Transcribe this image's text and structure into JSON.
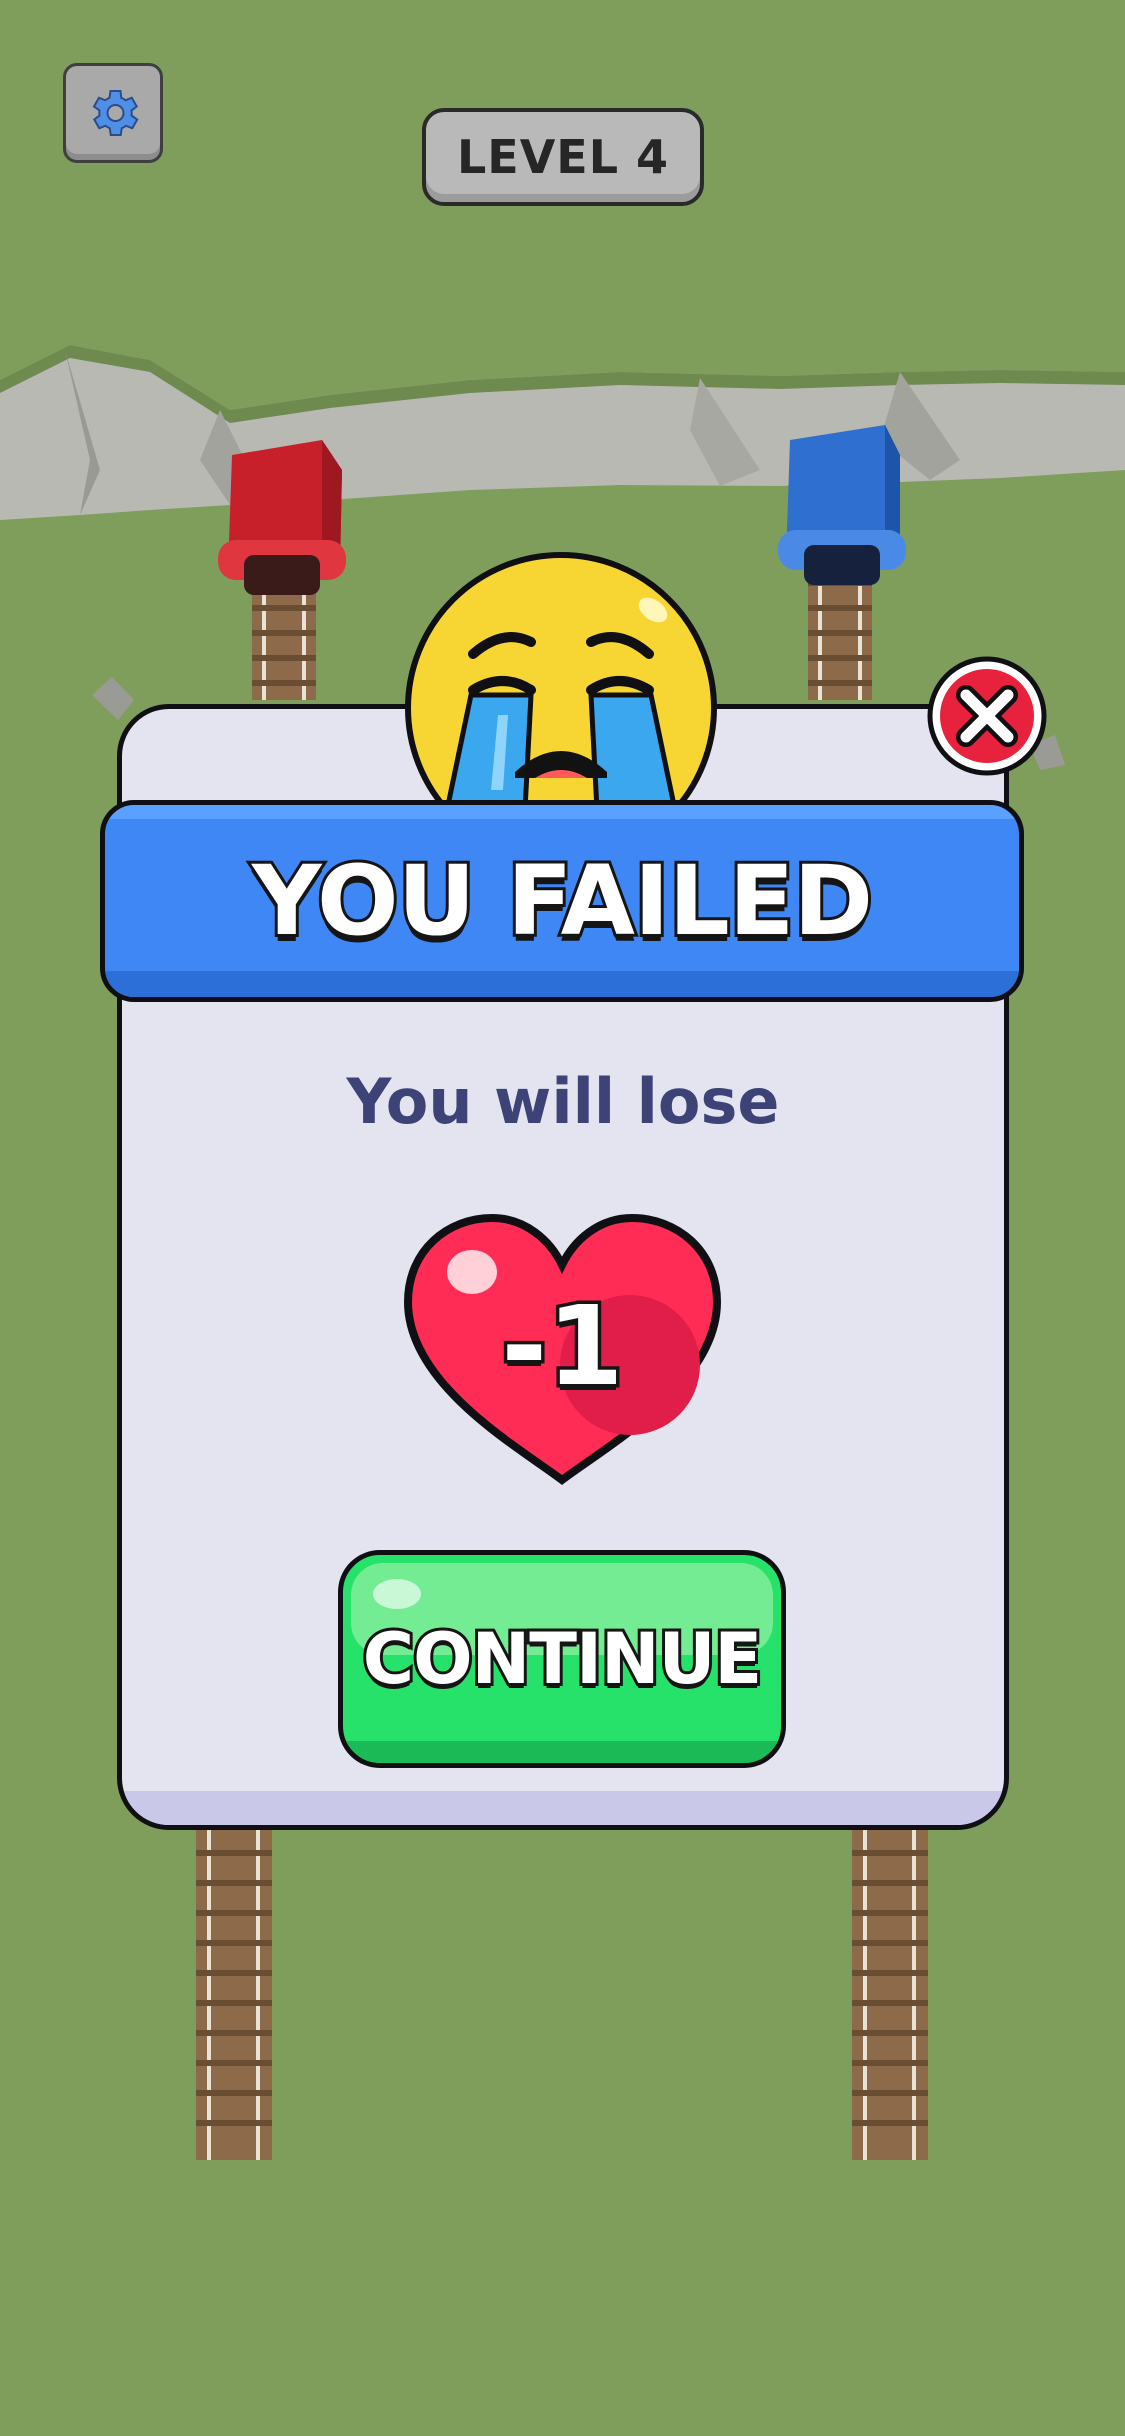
{
  "hud": {
    "settings_icon": "gear-icon",
    "level_label": "LEVEL 4"
  },
  "popup": {
    "title": "YOU FAILED",
    "emoji_icon": "crying-face-icon",
    "close_icon": "close-icon",
    "message": "You will lose",
    "lives_delta": "-1",
    "heart_icon": "heart-icon",
    "continue_label": "CONTINUE"
  },
  "colors": {
    "background": "#7f9e5c",
    "banner": "#3f87f5",
    "continue": "#27e26a",
    "heart": "#ff2d55",
    "close": "#e8223c",
    "red_tunnel": "#c8202a",
    "blue_tunnel": "#2f6fd0"
  }
}
